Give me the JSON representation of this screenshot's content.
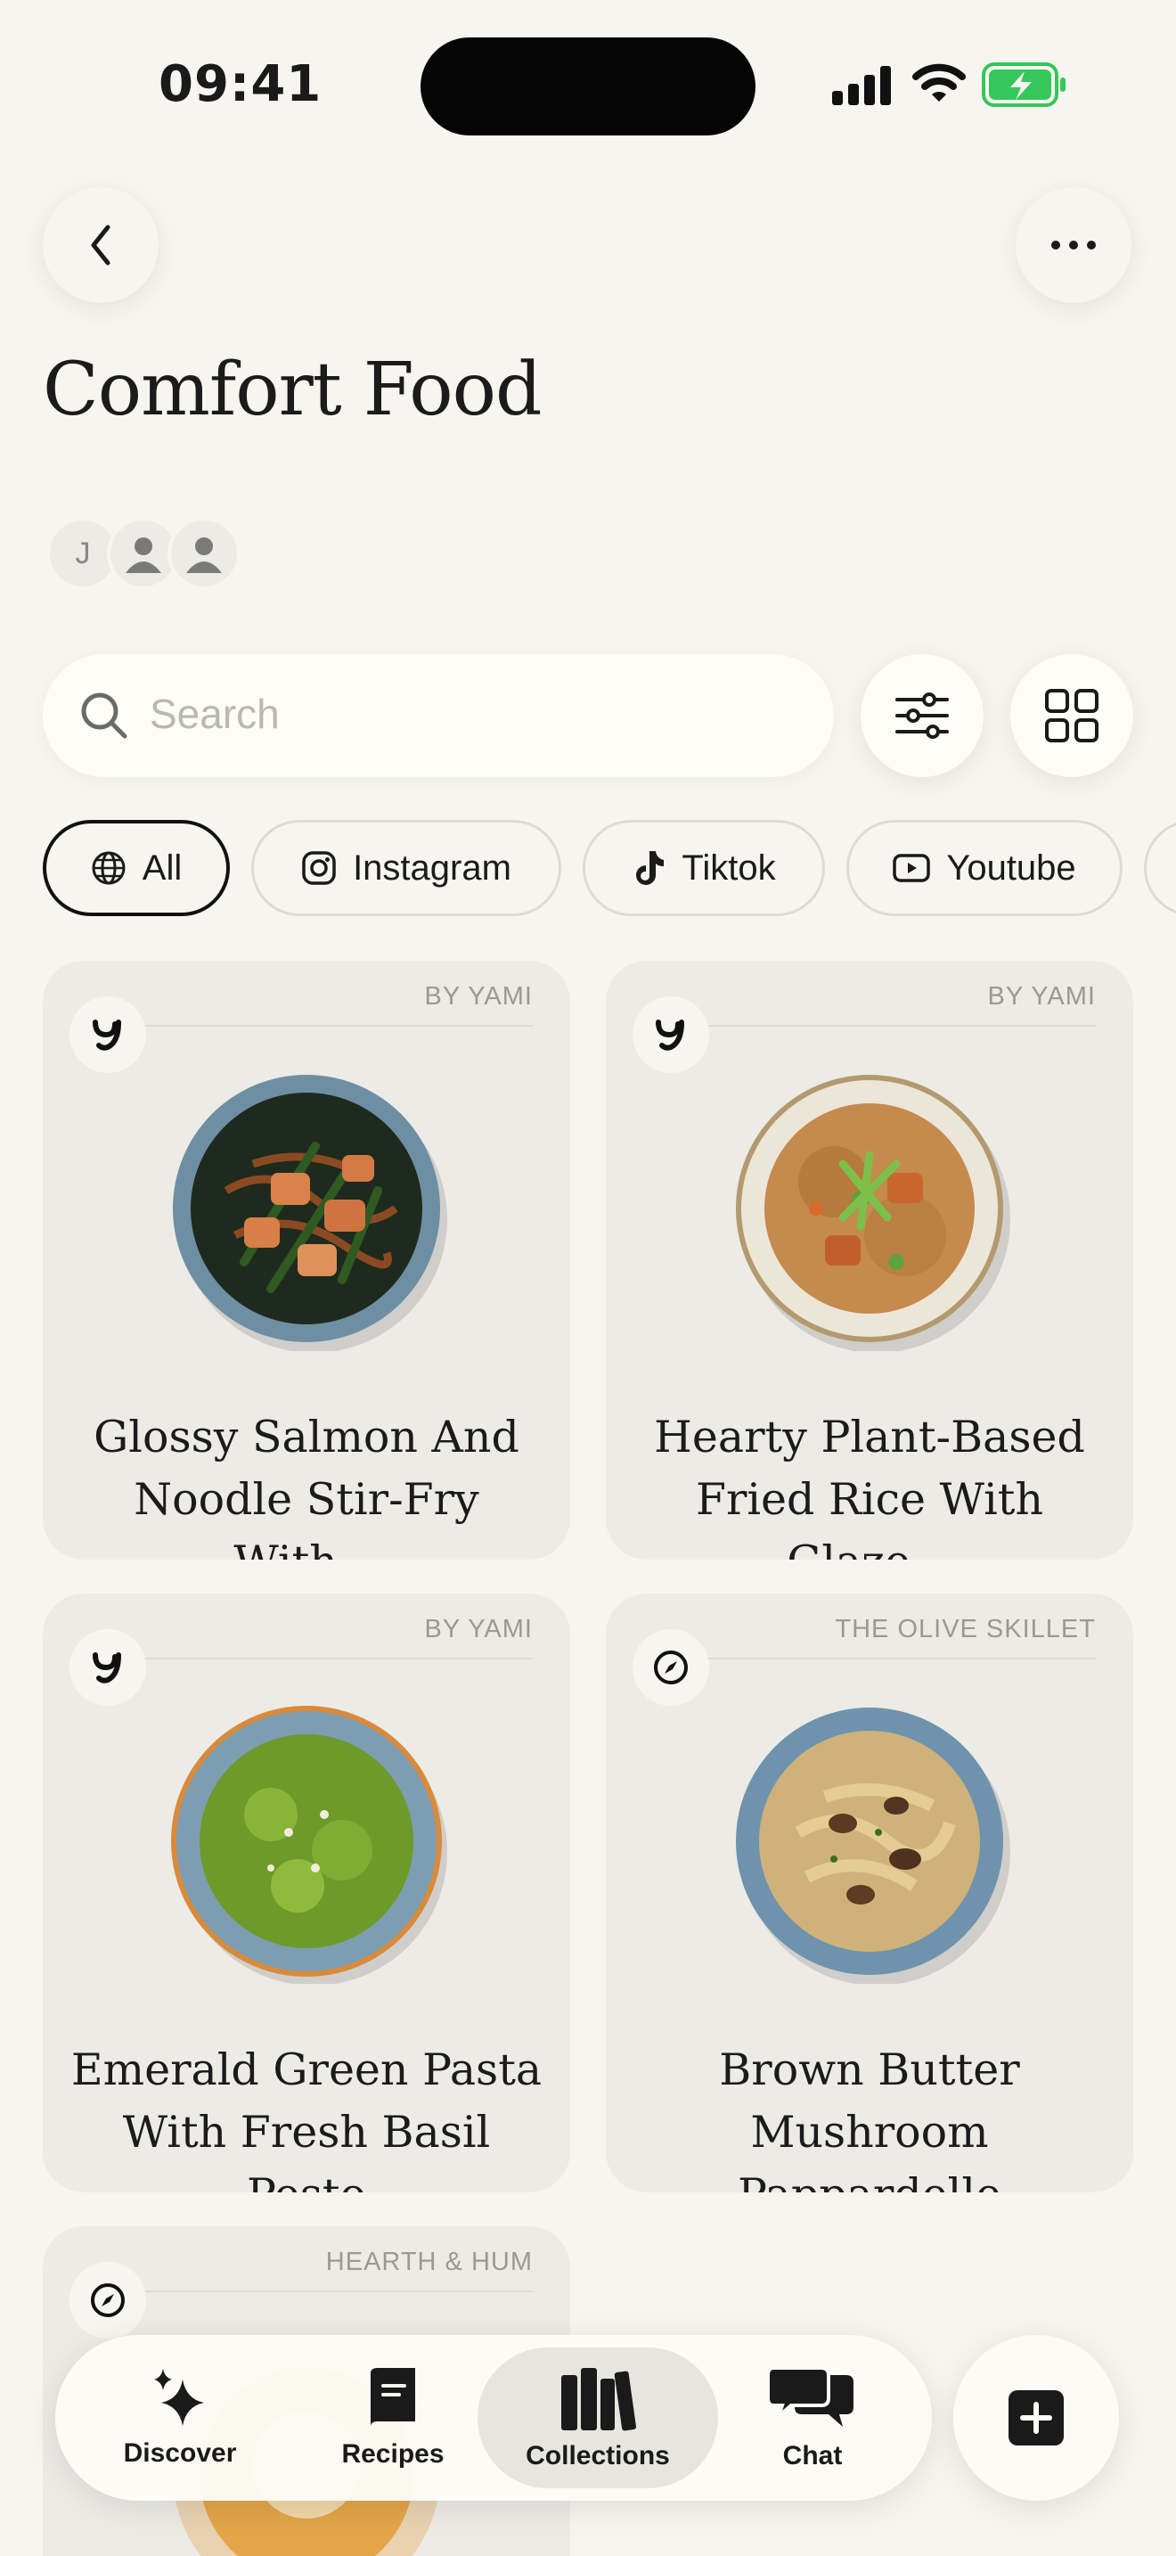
{
  "status_bar": {
    "time": "09:41"
  },
  "header": {
    "title": "Comfort Food"
  },
  "members": {
    "initial": "J"
  },
  "search": {
    "placeholder": "Search"
  },
  "filters": [
    {
      "label": "All",
      "icon": "globe-icon",
      "active": true
    },
    {
      "label": "Instagram",
      "icon": "instagram-icon",
      "active": false
    },
    {
      "label": "Tiktok",
      "icon": "tiktok-icon",
      "active": false
    },
    {
      "label": "Youtube",
      "icon": "youtube-icon",
      "active": false
    }
  ],
  "recipes": [
    {
      "source": "BY YAMI",
      "line1": "Glossy Salmon And",
      "line2": "Noodle Stir-Fry With...",
      "badge": "yami-logo-icon"
    },
    {
      "source": "BY YAMI",
      "line1": "Hearty Plant-Based",
      "line2": "Fried Rice With Glaze...",
      "badge": "yami-logo-icon"
    },
    {
      "source": "BY YAMI",
      "line1": "Emerald Green Pasta",
      "line2": "With Fresh Basil Pesto",
      "badge": "yami-logo-icon"
    },
    {
      "source": "THE OLIVE SKILLET",
      "line1": "Brown Butter Mushroom",
      "line2": "Pappardelle",
      "badge": "compass-icon"
    },
    {
      "source": "HEARTH & HUM",
      "line1": "",
      "line2": "",
      "badge": "compass-icon"
    }
  ],
  "nav": {
    "discover": "Discover",
    "recipes": "Recipes",
    "collections": "Collections",
    "chat": "Chat"
  },
  "colors": {
    "background": "#f6f5f0",
    "card": "#ecebe6",
    "battery": "#35c759"
  }
}
